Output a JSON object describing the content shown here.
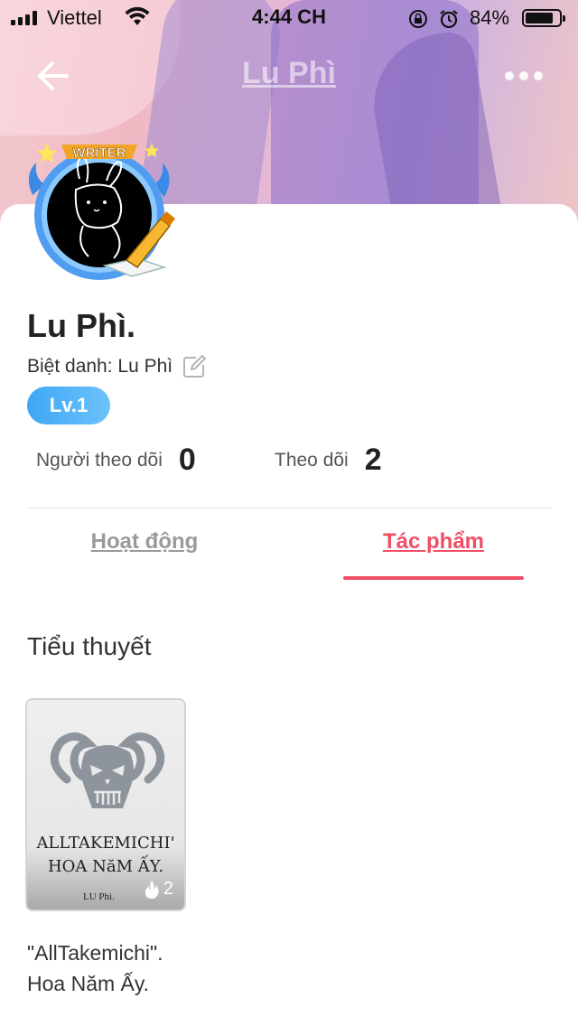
{
  "status_bar": {
    "carrier": "Viettel",
    "time": "4:44 CH",
    "battery_percent": "84%",
    "battery_level": 0.84
  },
  "nav": {
    "title": "Lu Phì",
    "back_icon": "back-arrow-icon",
    "more_icon": "more-dots-icon"
  },
  "profile": {
    "avatar_badge": "WRITER",
    "name": "Lu Phì.",
    "nickname_label": "Biệt danh: Lu Phì",
    "level": "Lv.1",
    "followers_label": "Người theo dõi",
    "followers_count": "0",
    "following_label": "Theo dõi",
    "following_count": "2"
  },
  "tabs": [
    {
      "label": "Hoạt động",
      "active": false
    },
    {
      "label": "Tác phẩm",
      "active": true
    }
  ],
  "section": {
    "title": "Tiểu thuyết"
  },
  "books": [
    {
      "cover_title": "ALLTAKEMICHI'\nHOA NăM ẤY.",
      "cover_author": "LU Phì.",
      "reads": "2",
      "title": "\"AllTakemichi\".\nHoa Năm Ấy."
    }
  ],
  "colors": {
    "accent": "#f04f66",
    "level_badge": "#3fa6f5"
  }
}
